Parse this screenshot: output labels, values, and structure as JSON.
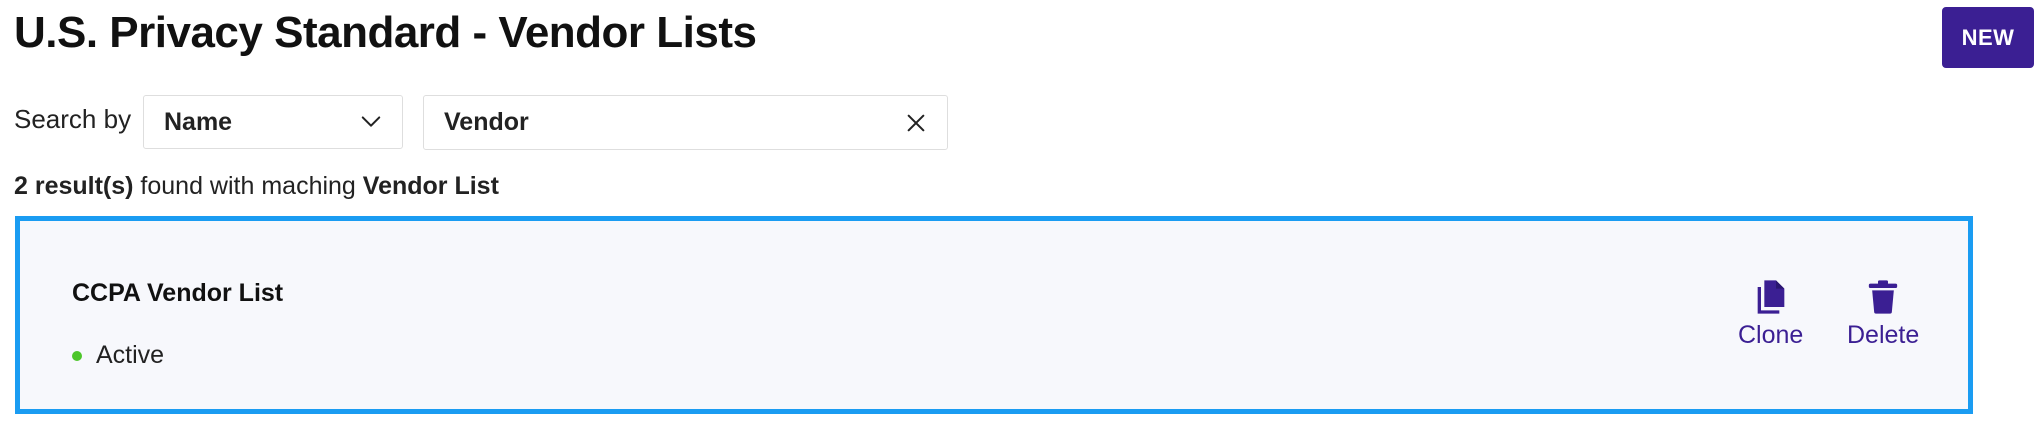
{
  "header": {
    "title": "U.S. Privacy Standard - Vendor Lists",
    "new_button_label": "NEW"
  },
  "search": {
    "label": "Search by",
    "field_select_value": "Name",
    "query_value": "Vendor"
  },
  "results": {
    "count_text": "2 result(s)",
    "middle_text": " found with maching ",
    "term_text": "Vendor List"
  },
  "vendor_lists": [
    {
      "name": "CCPA Vendor List",
      "status": "Active",
      "clone_label": "Clone",
      "delete_label": "Delete"
    }
  ],
  "colors": {
    "accent": "#3b1f93",
    "selected_border": "#1a9cf2",
    "active_status": "#4cc62a",
    "card_background": "#f7f8fc"
  }
}
